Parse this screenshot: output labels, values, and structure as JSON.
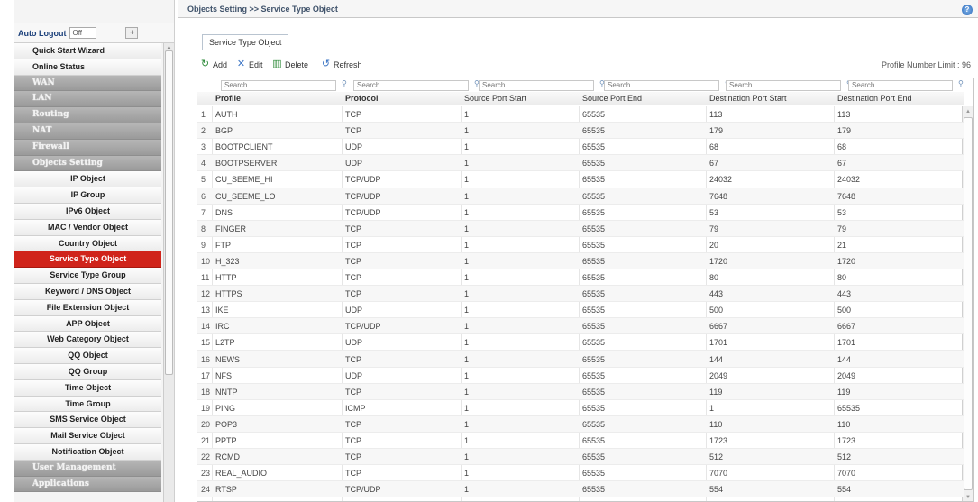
{
  "breadcrumb": "Objects Setting >> Service Type Object",
  "help_icon": "?",
  "auto_logout": {
    "label": "Auto Logout",
    "value": "Off",
    "button": "+"
  },
  "menu": [
    {
      "label": "Quick Start Wizard",
      "kind": "top"
    },
    {
      "label": "Online Status",
      "kind": "top"
    },
    {
      "label": "WAN",
      "kind": "cat"
    },
    {
      "label": "LAN",
      "kind": "cat"
    },
    {
      "label": "Routing",
      "kind": "cat"
    },
    {
      "label": "NAT",
      "kind": "cat"
    },
    {
      "label": "Firewall",
      "kind": "cat"
    },
    {
      "label": "Objects Setting",
      "kind": "cat"
    },
    {
      "label": "IP Object",
      "kind": "sub"
    },
    {
      "label": "IP Group",
      "kind": "sub"
    },
    {
      "label": "IPv6 Object",
      "kind": "sub"
    },
    {
      "label": "MAC / Vendor Object",
      "kind": "sub"
    },
    {
      "label": "Country Object",
      "kind": "sub"
    },
    {
      "label": "Service Type Object",
      "kind": "active"
    },
    {
      "label": "Service Type Group",
      "kind": "sub"
    },
    {
      "label": "Keyword / DNS Object",
      "kind": "sub"
    },
    {
      "label": "File Extension Object",
      "kind": "sub"
    },
    {
      "label": "APP Object",
      "kind": "sub"
    },
    {
      "label": "Web Category Object",
      "kind": "sub"
    },
    {
      "label": "QQ Object",
      "kind": "sub"
    },
    {
      "label": "QQ Group",
      "kind": "sub"
    },
    {
      "label": "Time Object",
      "kind": "sub"
    },
    {
      "label": "Time Group",
      "kind": "sub"
    },
    {
      "label": "SMS Service Object",
      "kind": "sub"
    },
    {
      "label": "Mail Service Object",
      "kind": "sub"
    },
    {
      "label": "Notification Object",
      "kind": "sub"
    },
    {
      "label": "User Management",
      "kind": "cat"
    },
    {
      "label": "Applications",
      "kind": "cat"
    }
  ],
  "tab_label": "Service Type Object",
  "toolbar": {
    "add": "Add",
    "edit": "Edit",
    "delete": "Delete",
    "refresh": "Refresh",
    "limit": "Profile Number Limit : 96"
  },
  "search_placeholder": "Search",
  "columns": [
    "Profile",
    "Protocol",
    "Source Port Start",
    "Source Port End",
    "Destination Port Start",
    "Destination Port End"
  ],
  "rows": [
    [
      "1",
      "AUTH",
      "TCP",
      "1",
      "65535",
      "113",
      "113"
    ],
    [
      "2",
      "BGP",
      "TCP",
      "1",
      "65535",
      "179",
      "179"
    ],
    [
      "3",
      "BOOTPCLIENT",
      "UDP",
      "1",
      "65535",
      "68",
      "68"
    ],
    [
      "4",
      "BOOTPSERVER",
      "UDP",
      "1",
      "65535",
      "67",
      "67"
    ],
    [
      "5",
      "CU_SEEME_HI",
      "TCP/UDP",
      "1",
      "65535",
      "24032",
      "24032"
    ],
    [
      "6",
      "CU_SEEME_LO",
      "TCP/UDP",
      "1",
      "65535",
      "7648",
      "7648"
    ],
    [
      "7",
      "DNS",
      "TCP/UDP",
      "1",
      "65535",
      "53",
      "53"
    ],
    [
      "8",
      "FINGER",
      "TCP",
      "1",
      "65535",
      "79",
      "79"
    ],
    [
      "9",
      "FTP",
      "TCP",
      "1",
      "65535",
      "20",
      "21"
    ],
    [
      "10",
      "H_323",
      "TCP",
      "1",
      "65535",
      "1720",
      "1720"
    ],
    [
      "11",
      "HTTP",
      "TCP",
      "1",
      "65535",
      "80",
      "80"
    ],
    [
      "12",
      "HTTPS",
      "TCP",
      "1",
      "65535",
      "443",
      "443"
    ],
    [
      "13",
      "IKE",
      "UDP",
      "1",
      "65535",
      "500",
      "500"
    ],
    [
      "14",
      "IRC",
      "TCP/UDP",
      "1",
      "65535",
      "6667",
      "6667"
    ],
    [
      "15",
      "L2TP",
      "UDP",
      "1",
      "65535",
      "1701",
      "1701"
    ],
    [
      "16",
      "NEWS",
      "TCP",
      "1",
      "65535",
      "144",
      "144"
    ],
    [
      "17",
      "NFS",
      "UDP",
      "1",
      "65535",
      "2049",
      "2049"
    ],
    [
      "18",
      "NNTP",
      "TCP",
      "1",
      "65535",
      "119",
      "119"
    ],
    [
      "19",
      "PING",
      "ICMP",
      "1",
      "65535",
      "1",
      "65535"
    ],
    [
      "20",
      "POP3",
      "TCP",
      "1",
      "65535",
      "110",
      "110"
    ],
    [
      "21",
      "PPTP",
      "TCP",
      "1",
      "65535",
      "1723",
      "1723"
    ],
    [
      "22",
      "RCMD",
      "TCP",
      "1",
      "65535",
      "512",
      "512"
    ],
    [
      "23",
      "REAL_AUDIO",
      "TCP",
      "1",
      "65535",
      "7070",
      "7070"
    ],
    [
      "24",
      "RTSP",
      "TCP/UDP",
      "1",
      "65535",
      "554",
      "554"
    ]
  ]
}
